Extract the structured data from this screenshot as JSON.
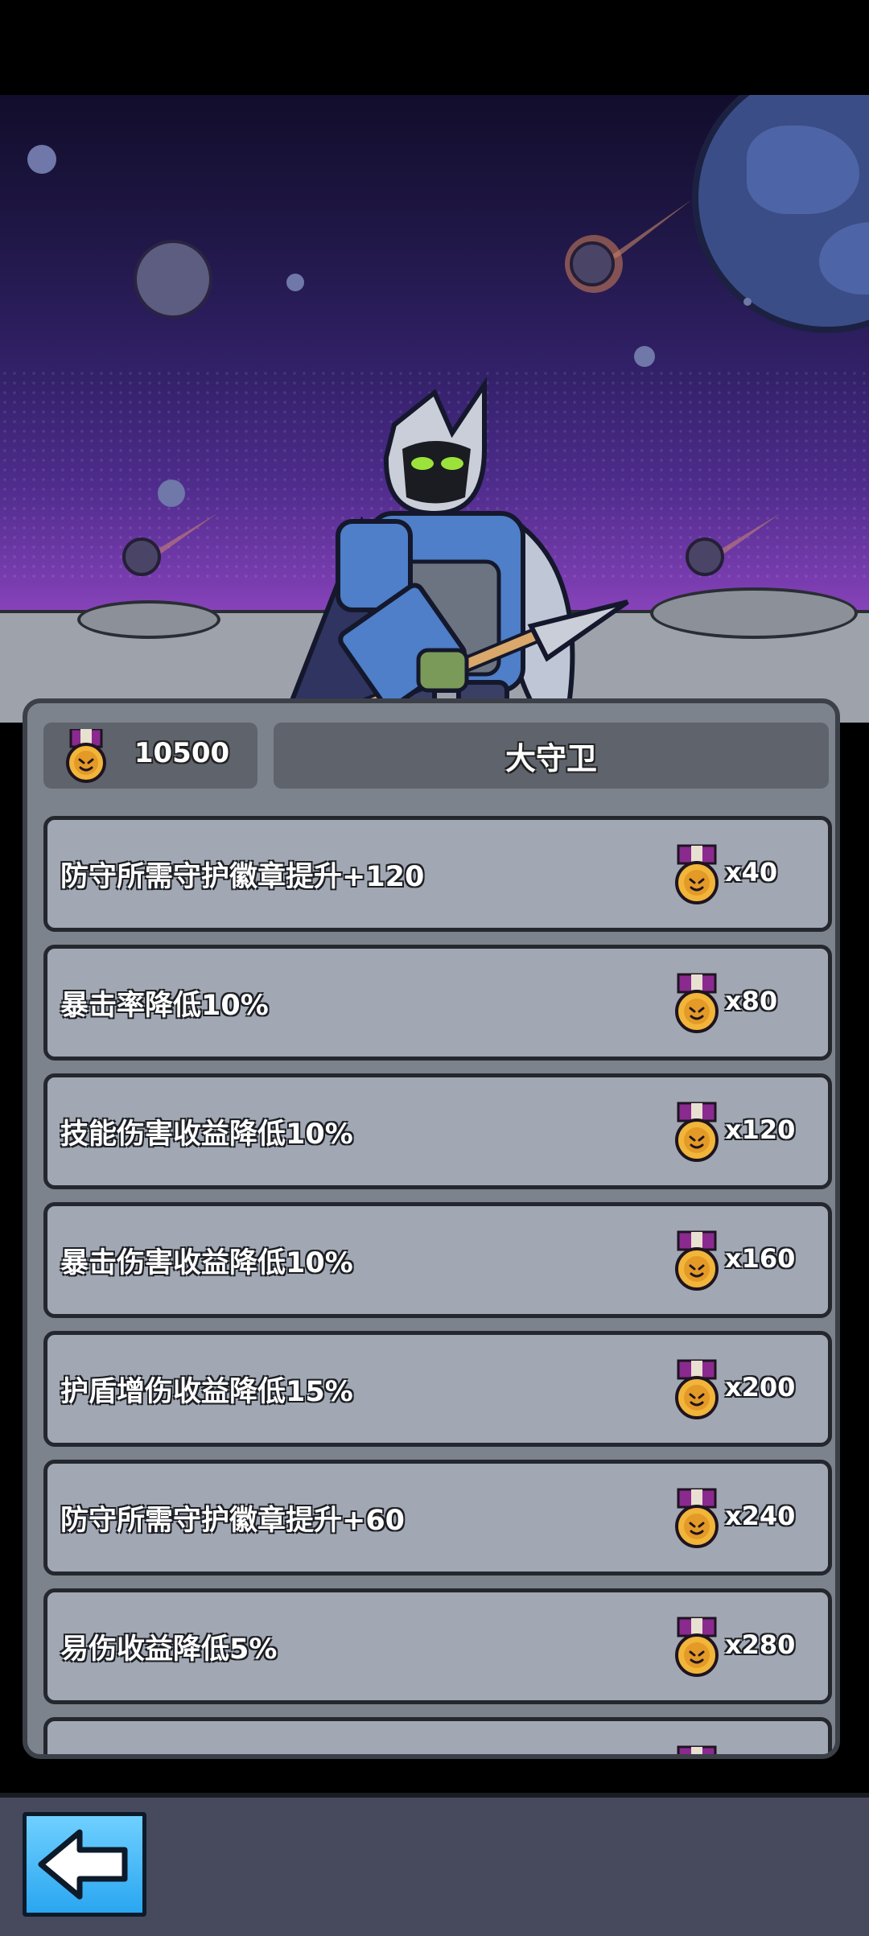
{
  "header": {
    "medal_count": "10500",
    "title": "大守卫"
  },
  "upgrades": [
    {
      "desc": "防守所需守护徽章提升+120",
      "cost": "x40"
    },
    {
      "desc": "暴击率降低10%",
      "cost": "x80"
    },
    {
      "desc": "技能伤害收益降低10%",
      "cost": "x120"
    },
    {
      "desc": "暴击伤害收益降低10%",
      "cost": "x160"
    },
    {
      "desc": "护盾增伤收益降低15%",
      "cost": "x200"
    },
    {
      "desc": "防守所需守护徽章提升+60",
      "cost": "x240"
    },
    {
      "desc": "易伤收益降低5%",
      "cost": "x280"
    }
  ],
  "icons": {
    "medal": "medal-icon",
    "back": "back-arrow-icon"
  },
  "colors": {
    "panel": "#7d838c",
    "row": "#a1a8b4",
    "back_button": "#2aa6f0",
    "medal_gold": "#f1b53a",
    "medal_ribbon": "#8a2a8f"
  }
}
